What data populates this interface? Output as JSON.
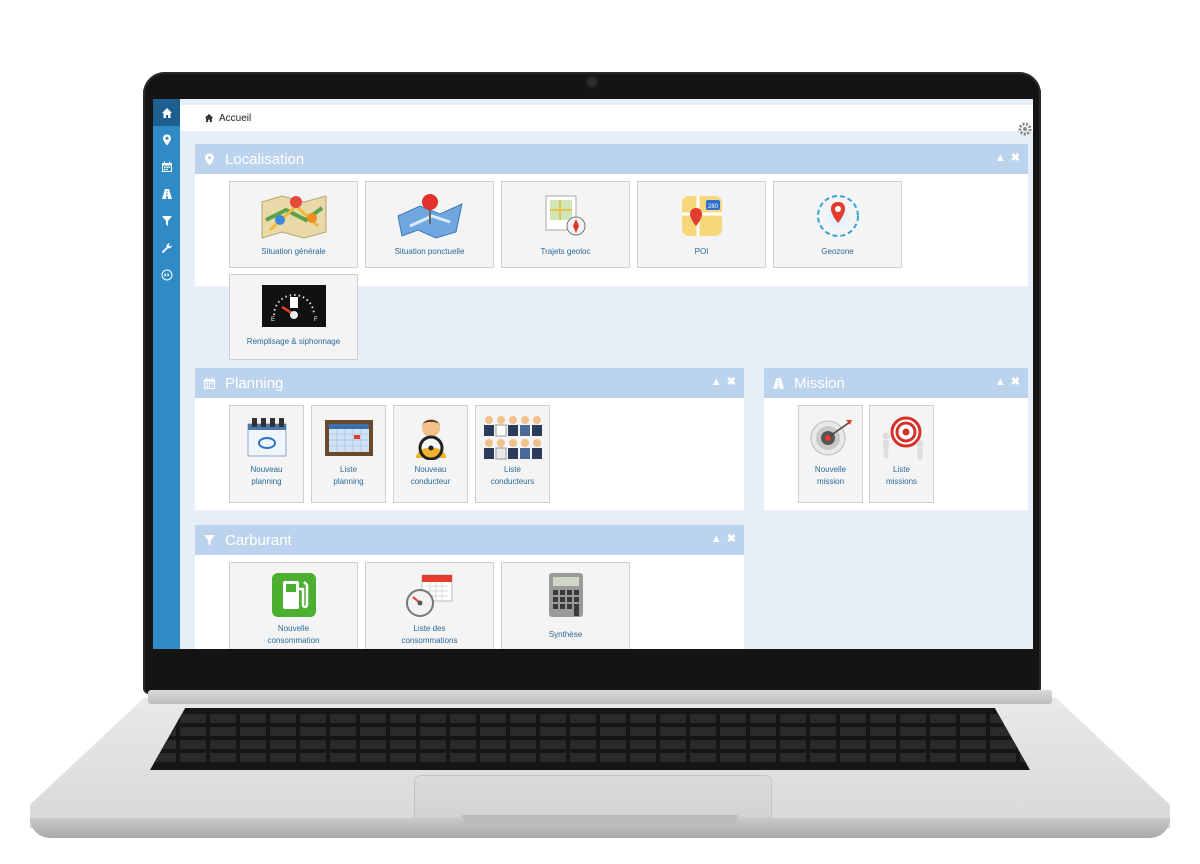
{
  "breadcrumb": {
    "label": "Accueil"
  },
  "sidebar": {
    "items": [
      "home",
      "location",
      "calendar",
      "road",
      "filter",
      "wrench",
      "expand"
    ]
  },
  "localisation": {
    "title": "Localisation",
    "tiles": [
      {
        "label": "Situation générale",
        "icon": "map-icon"
      },
      {
        "label": "Situation ponctuelle",
        "icon": "map-pin-icon"
      },
      {
        "label": "Trajets geoloc",
        "icon": "route-icon"
      },
      {
        "label": "POI",
        "icon": "poi-map-icon"
      },
      {
        "label": "Geozone",
        "icon": "geozone-icon"
      },
      {
        "label": "Remplisage & siphonnage",
        "icon": "fuel-gauge-icon"
      }
    ]
  },
  "planning": {
    "title": "Planning",
    "tiles": [
      {
        "line1": "Nouveau",
        "line2": "planning",
        "icon": "calendar-new-icon"
      },
      {
        "line1": "Liste",
        "line2": "planning",
        "icon": "calendar-list-icon"
      },
      {
        "line1": "Nouveau",
        "line2": "conducteur",
        "icon": "driver-icon"
      },
      {
        "line1": "Liste",
        "line2": "conducteurs",
        "icon": "drivers-group-icon"
      }
    ]
  },
  "mission": {
    "title": "Mission",
    "tiles": [
      {
        "line1": "Nouvelle",
        "line2": "mission",
        "icon": "target-icon"
      },
      {
        "line1": "Liste",
        "line2": "missions",
        "icon": "target-people-icon"
      }
    ]
  },
  "carburant": {
    "title": "Carburant",
    "tiles": [
      {
        "line1": "Nouvelle",
        "line2": "consommation",
        "icon": "fuel-pump-icon"
      },
      {
        "line1": "Liste des",
        "line2": "consommations",
        "icon": "fuel-calendar-icon"
      },
      {
        "line1": "Synthèse",
        "line2": "",
        "icon": "calculator-icon"
      }
    ]
  },
  "controls": {
    "collapse": "▲",
    "close": "✖"
  }
}
